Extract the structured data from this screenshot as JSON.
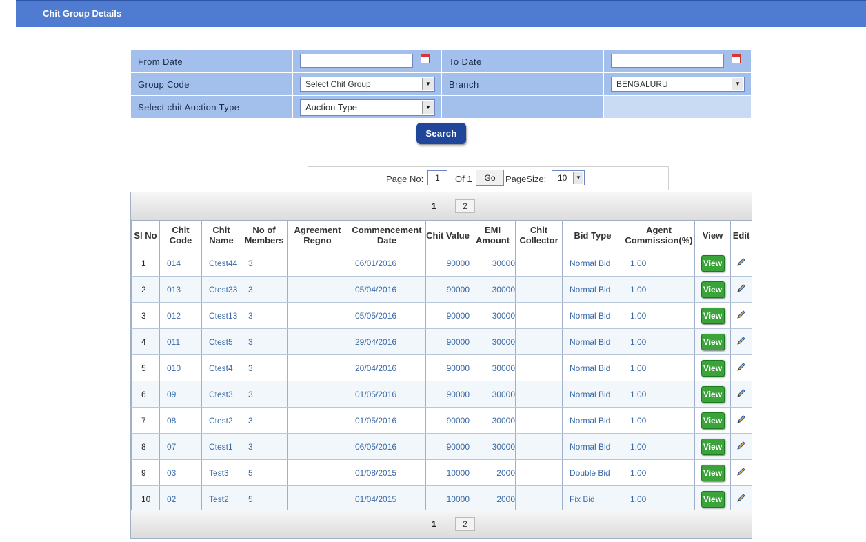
{
  "header": {
    "title": "Chit Group Details"
  },
  "form": {
    "from_date_label": "From Date",
    "to_date_label": "To Date",
    "from_date_value": "",
    "to_date_value": "",
    "group_code_label": "Group Code",
    "group_code_value": "Select Chit Group",
    "branch_label": "Branch",
    "branch_value": "BENGALURU",
    "auction_type_label": "Select chit Auction Type",
    "auction_type_value": "Auction Type",
    "search_label": "Search"
  },
  "pager": {
    "page_no_label": "Page No:",
    "page_no_value": "1",
    "of_label": "Of 1",
    "go_label": "Go",
    "page_size_label": "PageSize:",
    "page_size_value": "10",
    "current_page": "1",
    "next_page": "2"
  },
  "table": {
    "headers": {
      "sl": "Sl No",
      "chit_code": "Chit Code",
      "chit_name": "Chit Name",
      "members": "No of Members",
      "agreement": "Agreement Regno",
      "commencement": "Commencement Date",
      "chit_value": "Chit Value",
      "emi": "EMI Amount",
      "collector": "Chit Collector",
      "bid_type": "Bid Type",
      "commission": "Agent Commission(%)",
      "view": "View",
      "edit": "Edit"
    },
    "view_label": "View",
    "rows": [
      {
        "sl": "1",
        "code": "014",
        "name": "Ctest44",
        "members": "3",
        "agreement": "",
        "date": "06/01/2016",
        "value": "90000",
        "emi": "30000",
        "collector": "",
        "bid": "Normal Bid",
        "commission": "1.00"
      },
      {
        "sl": "2",
        "code": "013",
        "name": "Ctest33",
        "members": "3",
        "agreement": "",
        "date": "05/04/2016",
        "value": "90000",
        "emi": "30000",
        "collector": "",
        "bid": "Normal Bid",
        "commission": "1.00"
      },
      {
        "sl": "3",
        "code": "012",
        "name": "Ctest13",
        "members": "3",
        "agreement": "",
        "date": "05/05/2016",
        "value": "90000",
        "emi": "30000",
        "collector": "",
        "bid": "Normal Bid",
        "commission": "1.00"
      },
      {
        "sl": "4",
        "code": "011",
        "name": "Ctest5",
        "members": "3",
        "agreement": "",
        "date": "29/04/2016",
        "value": "90000",
        "emi": "30000",
        "collector": "",
        "bid": "Normal Bid",
        "commission": "1.00"
      },
      {
        "sl": "5",
        "code": "010",
        "name": "Ctest4",
        "members": "3",
        "agreement": "",
        "date": "20/04/2016",
        "value": "90000",
        "emi": "30000",
        "collector": "",
        "bid": "Normal Bid",
        "commission": "1.00"
      },
      {
        "sl": "6",
        "code": "09",
        "name": "Ctest3",
        "members": "3",
        "agreement": "",
        "date": "01/05/2016",
        "value": "90000",
        "emi": "30000",
        "collector": "",
        "bid": "Normal Bid",
        "commission": "1.00"
      },
      {
        "sl": "7",
        "code": "08",
        "name": "Ctest2",
        "members": "3",
        "agreement": "",
        "date": "01/05/2016",
        "value": "90000",
        "emi": "30000",
        "collector": "",
        "bid": "Normal Bid",
        "commission": "1.00"
      },
      {
        "sl": "8",
        "code": "07",
        "name": "Ctest1",
        "members": "3",
        "agreement": "",
        "date": "06/05/2016",
        "value": "90000",
        "emi": "30000",
        "collector": "",
        "bid": "Normal Bid",
        "commission": "1.00"
      },
      {
        "sl": "9",
        "code": "03",
        "name": "Test3",
        "members": "5",
        "agreement": "",
        "date": "01/08/2015",
        "value": "10000",
        "emi": "2000",
        "collector": "",
        "bid": "Double Bid",
        "commission": "1.00"
      },
      {
        "sl": "10",
        "code": "02",
        "name": "Test2",
        "members": "5",
        "agreement": "",
        "date": "01/04/2015",
        "value": "10000",
        "emi": "2000",
        "collector": "",
        "bid": "Fix Bid",
        "commission": "1.00"
      }
    ]
  },
  "icons": {
    "calendar": "calendar-icon",
    "edit": "pencil-icon",
    "dropdown": "chevron-down-icon"
  },
  "colors": {
    "header_bg": "#4f7bd0",
    "form_bg": "#a3c0ec",
    "search_btn": "#1f4699",
    "view_btn": "#3aa33a"
  }
}
